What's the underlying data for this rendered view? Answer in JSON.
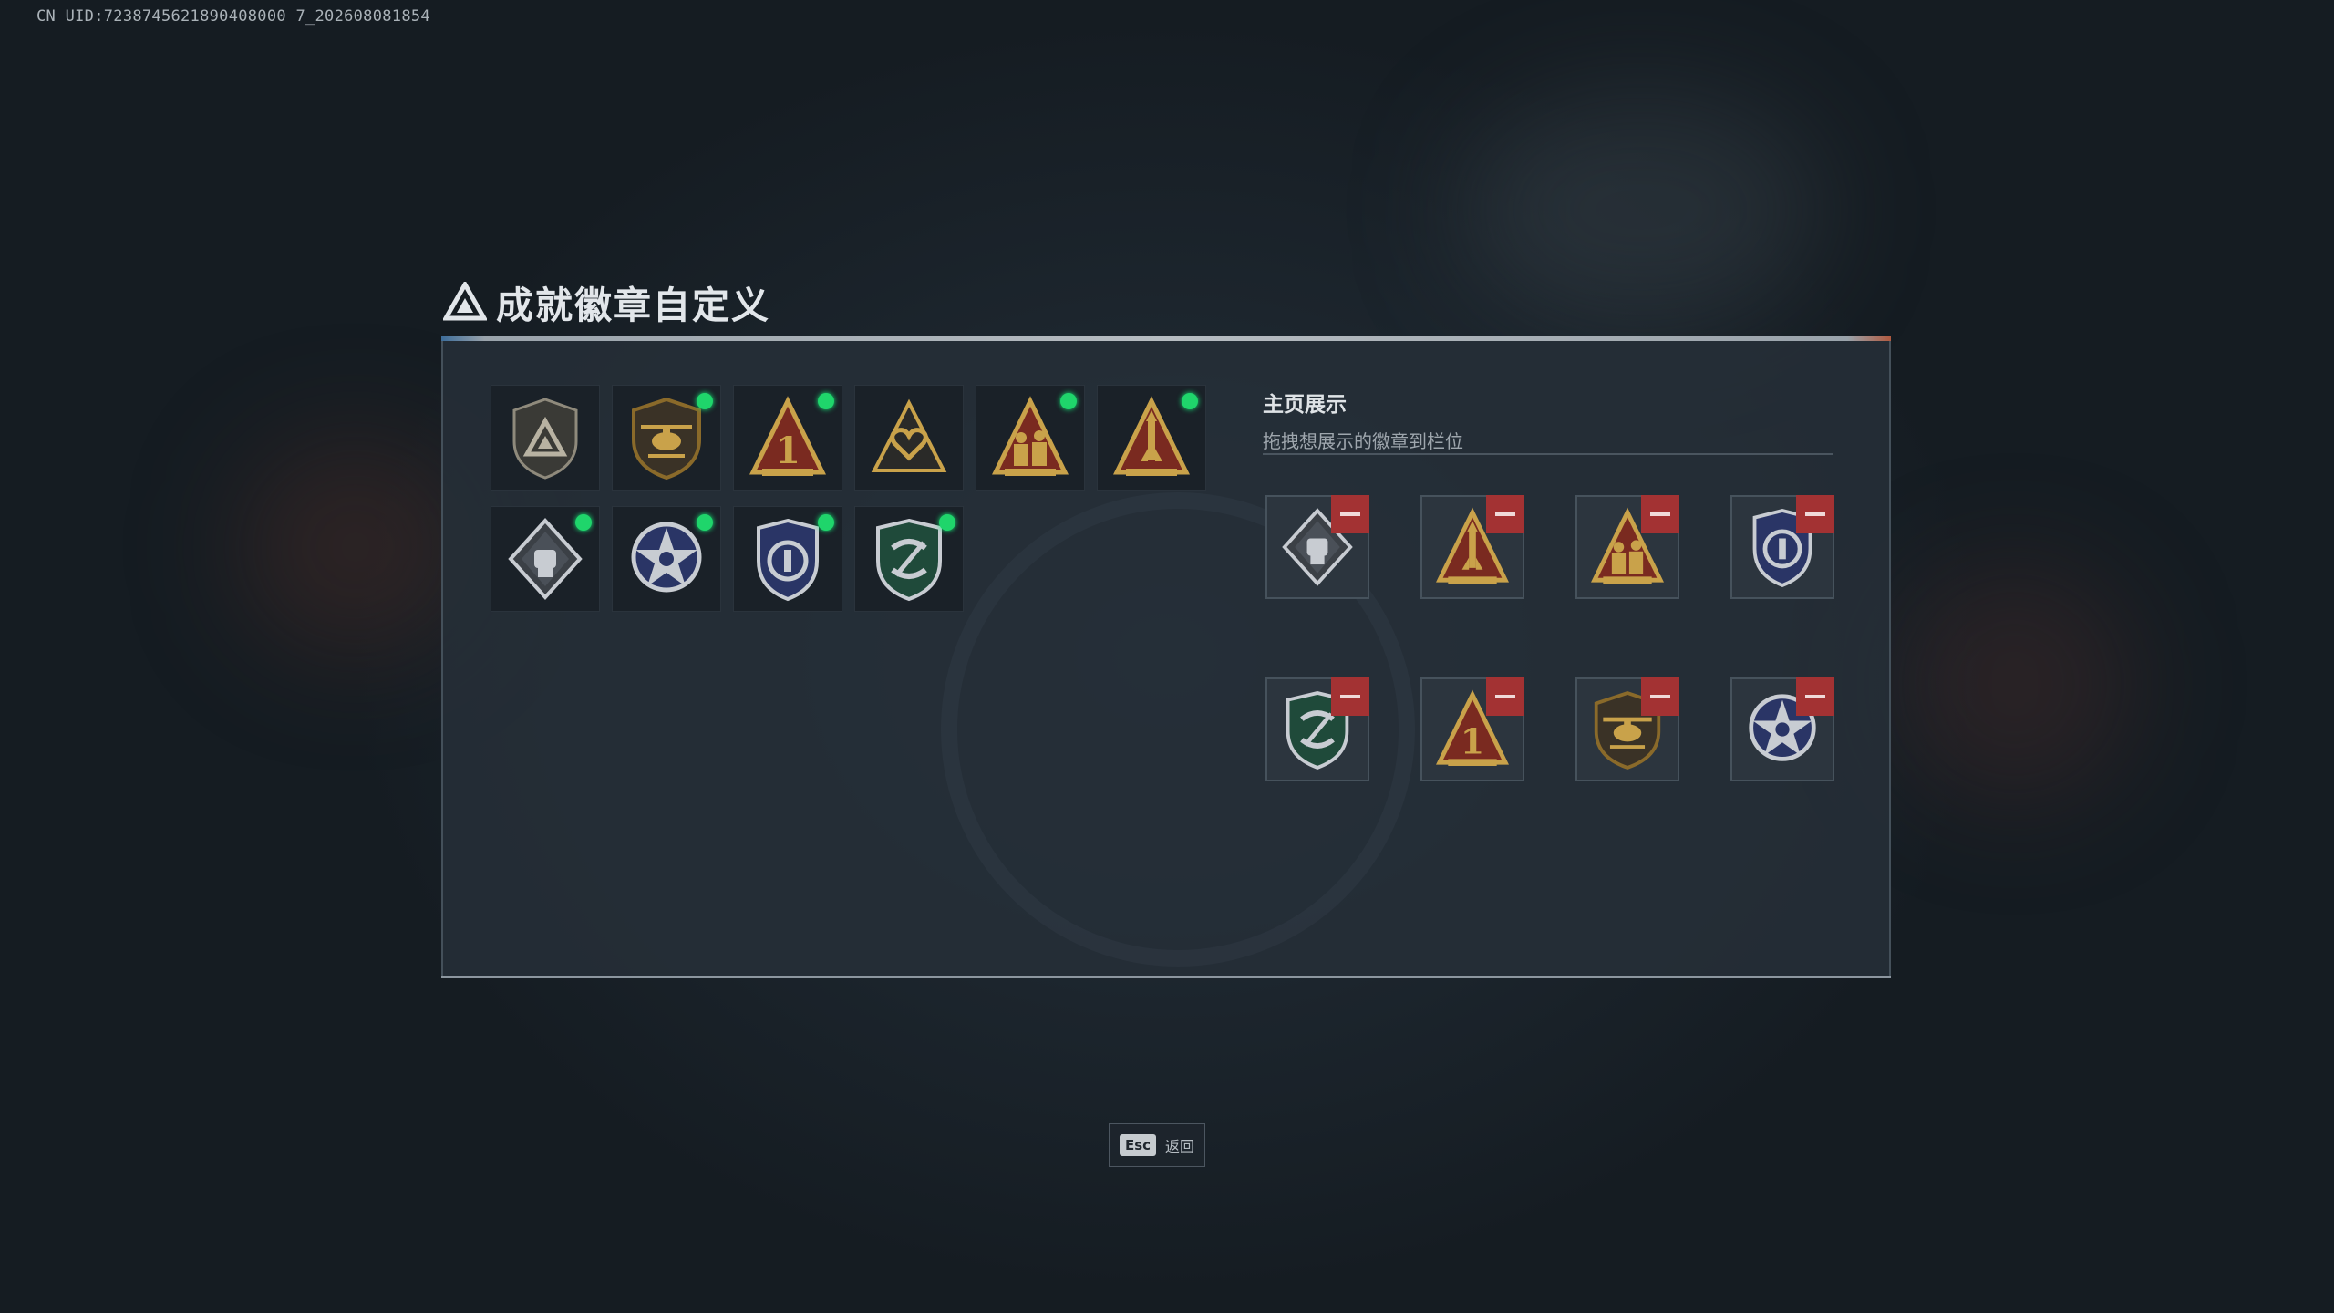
{
  "uid_text": "CN UID:7238745621890408000 7_202608081854",
  "title": "成就徽章自定义",
  "icons": {
    "title_logo": "triangle-emblem-icon"
  },
  "colors": {
    "new_dot": "#1fd56b",
    "remove": "#a33233",
    "accent_blue": "#3d6d9a",
    "accent_orange": "#b05a40"
  },
  "owned_badges": [
    {
      "name": "shield-triangle-badge",
      "new": false
    },
    {
      "name": "helicopter-badge",
      "new": true
    },
    {
      "name": "number-one-badge",
      "new": true
    },
    {
      "name": "heart-triangle-badge",
      "new": false
    },
    {
      "name": "soldiers-triangle-badge",
      "new": true
    },
    {
      "name": "rocket-triangle-badge",
      "new": true
    },
    {
      "name": "diamond-fist-badge",
      "new": true
    },
    {
      "name": "star-wreath-badge",
      "new": true
    },
    {
      "name": "police-shield-badge",
      "new": true
    },
    {
      "name": "green-arrows-shield-badge",
      "new": true
    }
  ],
  "showcase": {
    "title": "主页展示",
    "subtitle": "拖拽想展示的徽章到栏位",
    "slots": [
      "diamond-fist-badge",
      "rocket-triangle-badge",
      "soldiers-triangle-badge",
      "police-shield-badge",
      "green-arrows-shield-badge",
      "number-one-badge",
      "helicopter-badge",
      "star-wreath-badge"
    ]
  },
  "footer": {
    "esc_key": "Esc",
    "esc_label": "返回"
  }
}
